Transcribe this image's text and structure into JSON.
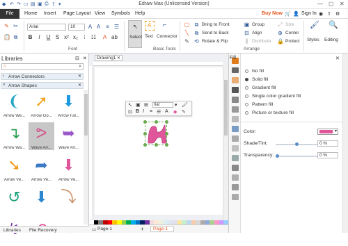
{
  "titlebar": {
    "title": "Edraw Max (Unlicensed Version)",
    "window_controls": [
      "—",
      "▢",
      "✕"
    ]
  },
  "menubar": {
    "items": [
      "File",
      "Home",
      "Insert",
      "Page Layout",
      "View",
      "Symbols",
      "Help"
    ],
    "buy_now": "Buy Now",
    "sign_in": "Sign In"
  },
  "ribbon": {
    "font_name": "Arial",
    "font_size": "10",
    "groups": {
      "font": "Font",
      "basic_tools": "Basic Tools",
      "arrange": "Arrange"
    },
    "tools": {
      "select": "Select",
      "text": "Text",
      "connector": "Connector"
    },
    "arrange": {
      "bring_to_front": "Bring to Front",
      "send_to_back": "Send to Back",
      "rotate_flip": "Rotate & Flip",
      "group": "Group",
      "align": "Align",
      "distribute": "Distribute",
      "size": "Size",
      "center": "Center",
      "protect": "Protect"
    },
    "styles": "Styles",
    "editing": "Editing"
  },
  "libraries": {
    "title": "Libraries",
    "categories": [
      "Arrow Connectors",
      "Arrow Shapes"
    ],
    "shapes": [
      {
        "label": "Arrow We...",
        "color": "#27a8c4",
        "glyph": "❨"
      },
      {
        "label": "Arrow Go...",
        "color": "#f4a21b",
        "glyph": "➚"
      },
      {
        "label": "Arrow Fal...",
        "color": "#1e9be0",
        "glyph": "⬇"
      },
      {
        "label": "Arrow Wa...",
        "color": "#2e9f56",
        "glyph": "↴"
      },
      {
        "label": "Wave Arr...",
        "color": "#d1578d",
        "glyph": "ᕗ"
      },
      {
        "label": "Wave Arr...",
        "color": "#9b59c9",
        "glyph": "➥"
      },
      {
        "label": "Arrow Ve...",
        "color": "#f09a1a",
        "glyph": "➘"
      },
      {
        "label": "Arrow Ve...",
        "color": "#3a78c4",
        "glyph": "➦"
      },
      {
        "label": "Arrow Ve...",
        "color": "#e0569a",
        "glyph": "⬇"
      },
      {
        "label": "",
        "color": "#1aa178",
        "glyph": "↺"
      },
      {
        "label": "",
        "color": "#2a86d1",
        "glyph": "⬇"
      },
      {
        "label": "",
        "color": "#c98b5f",
        "glyph": "⤵"
      },
      {
        "label": "",
        "color": "#7a3fae",
        "glyph": "↯"
      },
      {
        "label": "",
        "color": "#e0569a",
        "glyph": "↶"
      },
      {
        "label": "",
        "color": "#2a86d1",
        "glyph": "➡"
      }
    ],
    "selected_index": 4,
    "bottom_tabs": [
      "Libraries",
      "File Recovery"
    ]
  },
  "canvas": {
    "tab": "Drawing1",
    "page_tabs": [
      "Page-1",
      "+",
      "Page-1"
    ],
    "mini_toolbar": {
      "font": "rial",
      "bold": "B",
      "italic": "I",
      "underline": "U",
      "align": "≡",
      "bullets": "☰"
    },
    "palette": [
      "#ffffff",
      "#000000",
      "#7f7f7f",
      "#c00000",
      "#ff0000",
      "#ffc000",
      "#ffff00",
      "#92d050",
      "#00b050",
      "#00b0f0",
      "#0070c0",
      "#002060",
      "#7030a0",
      "#f2dcdb",
      "#fde9d9",
      "#ebf1dd",
      "#dbeef3",
      "#dce6f1",
      "#e4dfec",
      "#ffe699",
      "#c6efce",
      "#bdd7ee",
      "#f8cbad",
      "#d9d9d9",
      "#aeaaaa",
      "#8ea9db",
      "#a9d08e",
      "#ff99cc",
      "#cc99ff",
      "#99ccff"
    ]
  },
  "fill_panel": {
    "title": "Fill",
    "options": [
      "No fill",
      "Solid fill",
      "Gradient fill",
      "Single color gradient fill",
      "Pattern fill",
      "Picture or texture fill"
    ],
    "selected_option": 1,
    "color_label": "Color:",
    "color": "#e0569a",
    "shade_label": "Shade/Tint:",
    "shade_value": "0 %",
    "transparency_label": "Transparency:",
    "transparency_value": "0 %"
  }
}
